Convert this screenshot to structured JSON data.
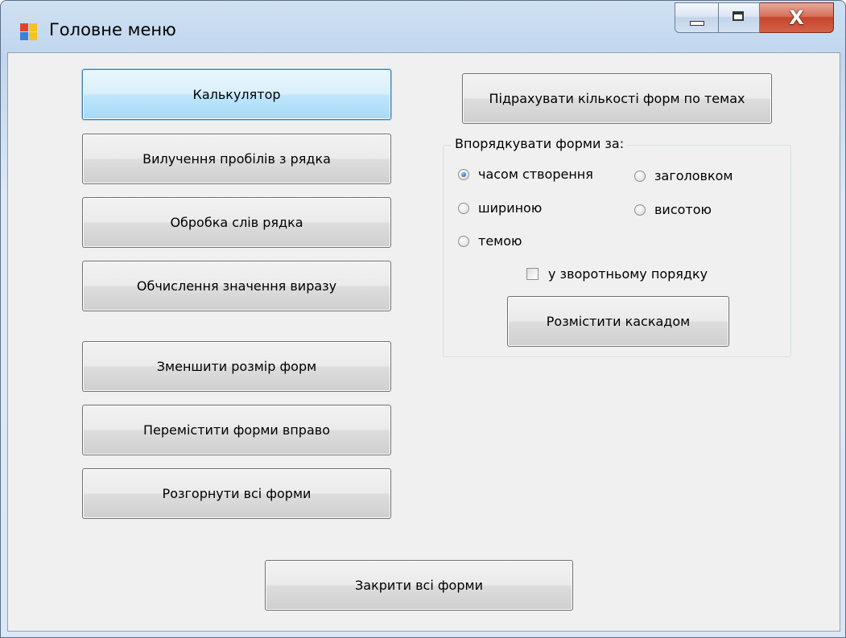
{
  "window": {
    "title": "Головне меню",
    "close_glyph": "X"
  },
  "left_buttons": {
    "calculator": "Калькулятор",
    "remove_spaces": "Вилучення пробілів з рядка",
    "process_words": "Обробка слів рядка",
    "evaluate_expression": "Обчислення значення виразу",
    "shrink_forms": "Зменшити розмір форм",
    "move_forms_right": "Перемістити форми вправо",
    "maximize_forms": "Розгорнути всі форми"
  },
  "count_forms_button": "Підрахувати кількості форм по темах",
  "sort_group": {
    "label": "Впорядкувати форми за:",
    "options": {
      "creation_time": "часом створення",
      "title": "заголовком",
      "width": "шириною",
      "height": "висотою",
      "theme": "темою"
    },
    "selected": "часом створення",
    "reverse_label": "у зворотньому порядку",
    "reverse_checked": false,
    "cascade_button": "Розмістити каскадом"
  },
  "close_all_button": "Закрити всі форми",
  "icons": {
    "app": "windows-form-icon",
    "minimize": "minimize-icon",
    "maximize": "maximize-icon",
    "close": "close-icon"
  },
  "colors": {
    "focus_border": "#3c7fb1",
    "close_button": "#c6452c",
    "radio_checked": "#2a7fd3"
  }
}
